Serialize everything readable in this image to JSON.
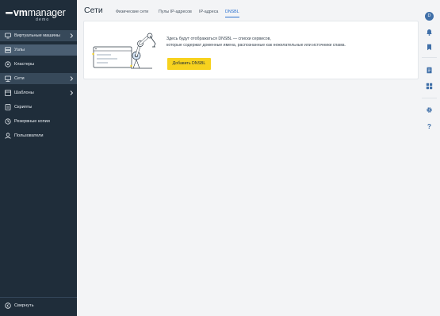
{
  "app": {
    "brand_vm": "vm",
    "brand_manager": "manager",
    "brand_sub": "demo"
  },
  "sidebar": {
    "items": [
      {
        "label": "Виртуальные машины",
        "icon": "monitor-icon",
        "has_chevron": true
      },
      {
        "label": "Узлы",
        "icon": "server-icon",
        "has_chevron": false
      },
      {
        "label": "Кластеры",
        "icon": "cluster-icon",
        "has_chevron": false
      },
      {
        "label": "Сети",
        "icon": "network-icon",
        "has_chevron": true
      },
      {
        "label": "Шаблоны",
        "icon": "template-icon",
        "has_chevron": true
      },
      {
        "label": "Скрипты",
        "icon": "script-icon",
        "has_chevron": false
      },
      {
        "label": "Резервные копии",
        "icon": "backup-icon",
        "has_chevron": false
      },
      {
        "label": "Пользователи",
        "icon": "user-icon",
        "has_chevron": false
      }
    ],
    "collapse_label": "Свернуть"
  },
  "header": {
    "title": "Сети",
    "tabs": [
      {
        "label": "Физические сети",
        "active": false
      },
      {
        "label": "Пулы IP-адресов",
        "active": false
      },
      {
        "label": "IP-адреса",
        "active": false
      },
      {
        "label": "DNSBL",
        "active": true
      }
    ]
  },
  "empty_state": {
    "line1": "Здесь будут отображаться DNSBL — списки сервисов,",
    "line2": "которые содержат доменные имена, распознанные как нежелательные или источники спама.",
    "button_label": "Добавить DNSBL"
  },
  "rail": {
    "avatar_letter": "D",
    "icons": [
      "bell-icon",
      "bookmark-icon",
      "document-icon",
      "widgets-icon",
      "gear-icon",
      "help-icon"
    ]
  },
  "colors": {
    "sidebar_bg": "#1f2d3a",
    "accent": "#2a6fcf",
    "button_yellow": "#f7d21e",
    "avatar": "#3f6fa8"
  }
}
